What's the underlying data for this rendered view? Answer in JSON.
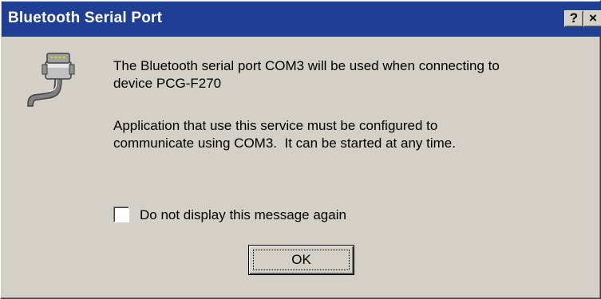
{
  "window": {
    "title": "Bluetooth Serial Port",
    "help_button_label": "?",
    "close_button_label": "×",
    "titlebar_color": "#1e3f93",
    "face_color": "#d4d0c8"
  },
  "icon": {
    "name": "serial-port-icon"
  },
  "message": {
    "line1": "The Bluetooth serial port COM3 will be used when connecting to\ndevice PCG-F270",
    "line2": "Application that use this service must be configured to\ncommunicate using COM3.  It can be started at any time."
  },
  "checkbox": {
    "label": "Do not display this message again",
    "checked": false
  },
  "ok_button": {
    "label": "OK"
  }
}
